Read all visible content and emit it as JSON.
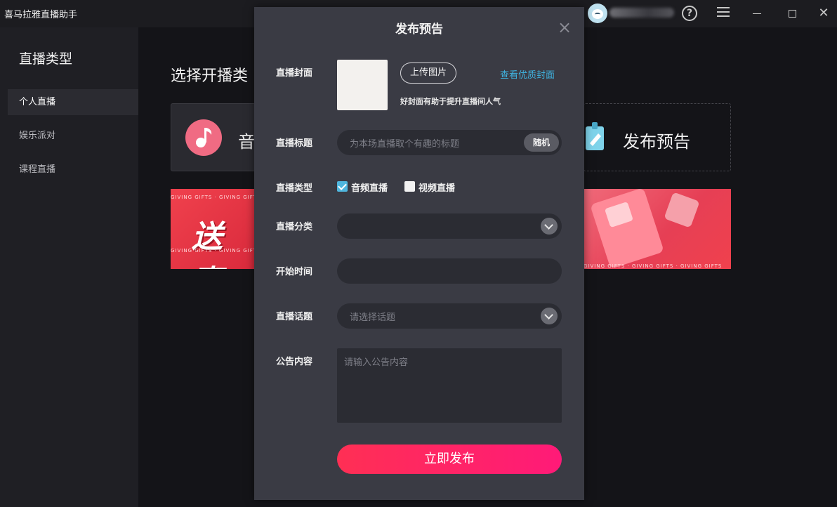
{
  "titlebar": {
    "app_title": "喜马拉雅直播助手",
    "help_glyph": "?",
    "close_glyph": "✕"
  },
  "sidebar": {
    "title": "直播类型",
    "items": [
      {
        "label": "个人直播",
        "active": true
      },
      {
        "label": "娱乐派对",
        "active": false
      },
      {
        "label": "课程直播",
        "active": false
      }
    ]
  },
  "main": {
    "heading": "选择开播类",
    "card_audio_label": "音",
    "card_preview_label": "发布预告",
    "banner_left_text": "送喜",
    "banner_strip_text": "GIVING GIFTS · GIVING GIFTS · GIVING GIFTS"
  },
  "modal": {
    "title": "发布预告",
    "close_glyph": "×",
    "cover": {
      "label": "直播封面",
      "upload_button": "上传图片",
      "quality_link": "查看优质封面",
      "hint": "好封面有助于提升直播间人气"
    },
    "title_field": {
      "label": "直播标题",
      "placeholder": "为本场直播取个有趣的标题",
      "random_button": "随机"
    },
    "type_field": {
      "label": "直播类型",
      "options": [
        {
          "label": "音频直播",
          "checked": true
        },
        {
          "label": "视频直播",
          "checked": false
        }
      ]
    },
    "category_field": {
      "label": "直播分类",
      "value": ""
    },
    "time_field": {
      "label": "开始时间",
      "value": ""
    },
    "topic_field": {
      "label": "直播话题",
      "placeholder": "请选择话题"
    },
    "announcement_field": {
      "label": "公告内容",
      "placeholder": "请输入公告内容"
    },
    "publish_button": "立即发布"
  },
  "colors": {
    "accent_blue": "#3fb3e0",
    "publish_gradient_start": "#ff2f54",
    "publish_gradient_end": "#ff1a78",
    "modal_bg": "#3a3b44"
  }
}
